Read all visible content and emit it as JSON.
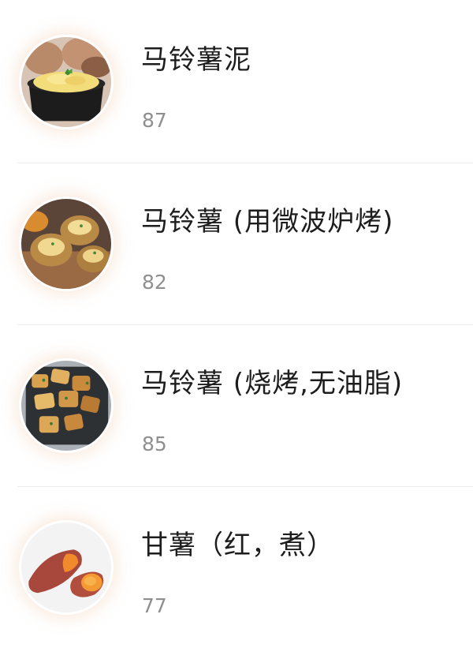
{
  "items": [
    {
      "name": "马铃薯泥",
      "value": "87",
      "icon": "mashed-potato-image"
    },
    {
      "name": "马铃薯 (用微波炉烤)",
      "value": "82",
      "icon": "microwave-baked-potato-image"
    },
    {
      "name": "马铃薯 (烧烤,无油脂)",
      "value": "85",
      "icon": "roasted-potato-image"
    },
    {
      "name": "甘薯（红，煮）",
      "value": "77",
      "icon": "sweet-potato-image"
    }
  ],
  "colors": {
    "title": "#1d1d1d",
    "value": "#8f8f8f",
    "divider": "#ececec",
    "glow": "#f0c8aa"
  }
}
